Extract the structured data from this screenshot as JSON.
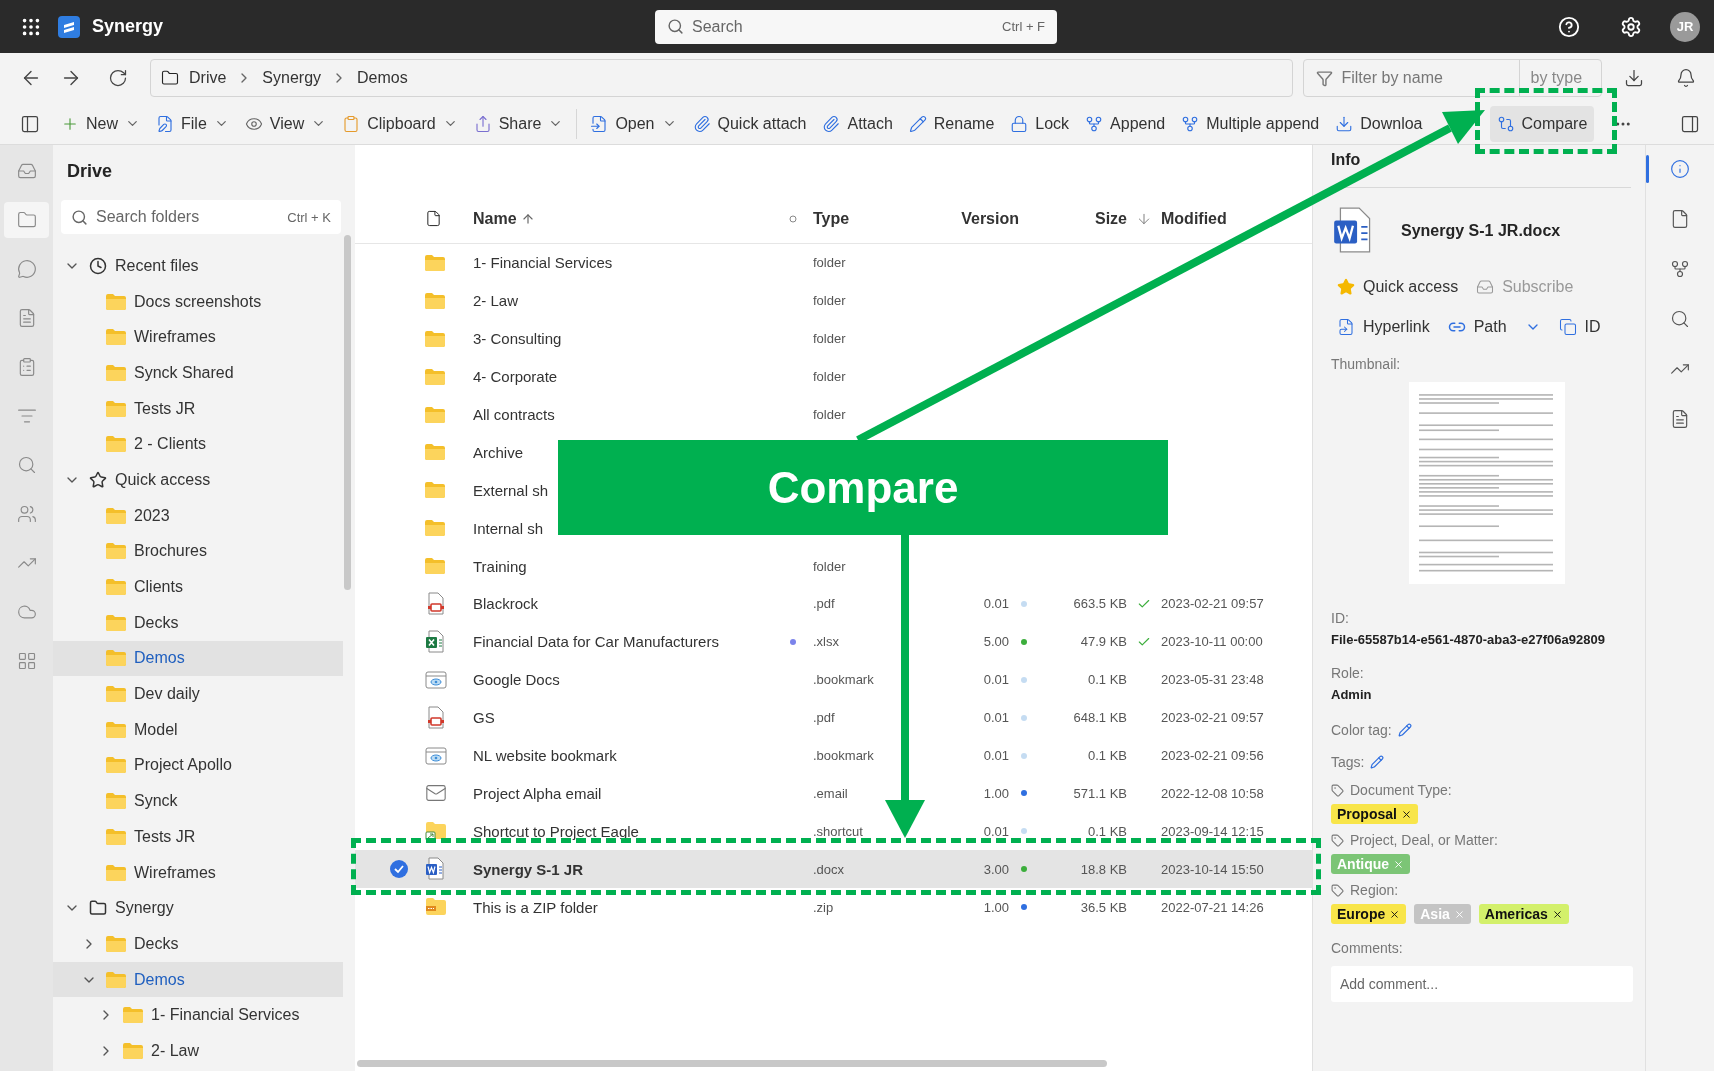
{
  "app": {
    "name": "Synergy",
    "search": {
      "placeholder": "Search",
      "shortcut": "Ctrl + F"
    },
    "avatar": "JR"
  },
  "breadcrumb": [
    {
      "label": "Drive"
    },
    {
      "label": "Synergy"
    },
    {
      "label": "Demos"
    }
  ],
  "filter": {
    "placeholder": "Filter by name",
    "type_label": "by type"
  },
  "toolbar": {
    "groups": [
      [
        {
          "label": "New",
          "dropdown": true,
          "selected": false
        },
        {
          "label": "File",
          "dropdown": true,
          "selected": false
        },
        {
          "label": "View",
          "dropdown": true,
          "selected": false
        },
        {
          "label": "Clipboard",
          "dropdown": true,
          "selected": false
        },
        {
          "label": "Share",
          "dropdown": true,
          "selected": false
        }
      ],
      [
        {
          "label": "Open",
          "dropdown": true,
          "selected": false
        },
        {
          "label": "Quick attach",
          "dropdown": false,
          "selected": false
        },
        {
          "label": "Attach",
          "dropdown": false,
          "selected": false
        },
        {
          "label": "Rename",
          "dropdown": false,
          "selected": false
        },
        {
          "label": "Lock",
          "dropdown": false,
          "selected": false
        },
        {
          "label": "Append",
          "dropdown": false,
          "selected": false
        },
        {
          "label": "Multiple append",
          "dropdown": false,
          "selected": false
        },
        {
          "label": "Downloa",
          "dropdown": false,
          "selected": false
        },
        {
          "label": "Compare",
          "dropdown": false,
          "selected": true
        }
      ]
    ]
  },
  "left_rail": [
    {
      "selected": false
    },
    {
      "selected": true
    },
    {
      "selected": false
    },
    {
      "selected": false
    },
    {
      "selected": false
    },
    {
      "selected": false
    },
    {
      "selected": false
    },
    {
      "selected": false
    },
    {
      "selected": false
    },
    {
      "selected": false
    },
    {
      "selected": false
    }
  ],
  "sidebar": {
    "title": "Drive",
    "search": {
      "placeholder": "Search folders",
      "shortcut": "Ctrl + K"
    },
    "tree": [
      {
        "label": "Recent files",
        "kind": "recent",
        "expanded": true,
        "selected": false,
        "children": [
          {
            "label": "Docs screenshots",
            "selected": false
          },
          {
            "label": "Wireframes",
            "selected": false
          },
          {
            "label": "Synck Shared",
            "selected": false
          },
          {
            "label": "Tests JR",
            "selected": false
          },
          {
            "label": "2 - Clients",
            "selected": false
          }
        ]
      },
      {
        "label": "Quick access",
        "kind": "favorites",
        "expanded": true,
        "selected": false,
        "children": [
          {
            "label": "2023",
            "selected": false
          },
          {
            "label": "Brochures",
            "selected": false
          },
          {
            "label": "Clients",
            "selected": false
          },
          {
            "label": "Decks",
            "selected": false
          },
          {
            "label": "Demos",
            "selected": true
          },
          {
            "label": "Dev daily",
            "selected": false
          },
          {
            "label": "Model",
            "selected": false
          },
          {
            "label": "Project Apollo",
            "selected": false
          },
          {
            "label": "Synck",
            "selected": false
          },
          {
            "label": "Tests JR",
            "selected": false
          },
          {
            "label": "Wireframes",
            "selected": false
          }
        ]
      },
      {
        "label": "Synergy",
        "kind": "drive",
        "expanded": true,
        "selected": false,
        "children": [
          {
            "label": "Decks",
            "expanded": false,
            "selected": false
          },
          {
            "label": "Demos",
            "expanded": true,
            "selected": true,
            "children": [
              {
                "label": "1- Financial Services",
                "expanded": false,
                "selected": false
              },
              {
                "label": "2- Law",
                "expanded": false,
                "selected": false
              }
            ]
          }
        ]
      }
    ]
  },
  "table": {
    "columns": [
      {
        "label": "Name",
        "sorted": true
      },
      {
        "label": "Type"
      },
      {
        "label": "Version"
      },
      {
        "label": "Size"
      },
      {
        "label": "Modified"
      }
    ],
    "rows": [
      {
        "name": "1- Financial Services",
        "kind": "folder",
        "type": "folder",
        "selected": false,
        "flagged": false,
        "synced": false
      },
      {
        "name": "2- Law",
        "kind": "folder",
        "type": "folder",
        "selected": false,
        "flagged": false,
        "synced": false
      },
      {
        "name": "3- Consulting",
        "kind": "folder",
        "type": "folder",
        "selected": false,
        "flagged": false,
        "synced": false
      },
      {
        "name": "4- Corporate",
        "kind": "folder",
        "type": "folder",
        "selected": false,
        "flagged": false,
        "synced": false
      },
      {
        "name": "All contracts",
        "kind": "folder",
        "type": "folder",
        "selected": false,
        "flagged": false,
        "synced": false
      },
      {
        "name": "Archive",
        "kind": "folder",
        "selected": false,
        "flagged": false,
        "synced": false
      },
      {
        "name": "External sh",
        "kind": "folder",
        "selected": false,
        "flagged": false,
        "synced": false
      },
      {
        "name": "Internal sh",
        "kind": "folder",
        "selected": false,
        "flagged": false,
        "synced": false
      },
      {
        "name": "Training",
        "kind": "folder",
        "type": "folder",
        "selected": false,
        "flagged": false,
        "synced": false
      },
      {
        "name": "Blackrock",
        "kind": "pdf",
        "type": ".pdf",
        "version": "0.01",
        "color": "#c5dcf2",
        "size": "663.5 KB",
        "synced": true,
        "modified": "2023-02-21 09:57",
        "selected": false,
        "flagged": false
      },
      {
        "name": "Financial Data for Car Manufacturers",
        "kind": "xlsx",
        "type": ".xlsx",
        "version": "5.00",
        "color": "#3cae3c",
        "size": "47.9 KB",
        "synced": true,
        "modified": "2023-10-11 00:00",
        "selected": false,
        "flagged": true
      },
      {
        "name": "Google Docs",
        "kind": "bookmark",
        "type": ".bookmark",
        "version": "0.01",
        "color": "#c5dcf2",
        "size": "0.1 KB",
        "synced": false,
        "modified": "2023-05-31 23:48",
        "selected": false,
        "flagged": false
      },
      {
        "name": "GS",
        "kind": "pdf",
        "type": ".pdf",
        "version": "0.01",
        "color": "#c5dcf2",
        "size": "648.1 KB",
        "synced": false,
        "modified": "2023-02-21 09:57",
        "selected": false,
        "flagged": false
      },
      {
        "name": "NL website bookmark",
        "kind": "bookmark",
        "type": ".bookmark",
        "version": "0.01",
        "color": "#c5dcf2",
        "size": "0.1 KB",
        "synced": false,
        "modified": "2023-02-21 09:56",
        "selected": false,
        "flagged": false
      },
      {
        "name": "Project Alpha email",
        "kind": "email",
        "type": ".email",
        "version": "1.00",
        "color": "#2f6fe0",
        "size": "571.1 KB",
        "synced": false,
        "modified": "2022-12-08 10:58",
        "selected": false,
        "flagged": false
      },
      {
        "name": "Shortcut to Project Eagle",
        "kind": "shortcut",
        "type": ".shortcut",
        "version": "0.01",
        "color": "#c5dcf2",
        "size": "0.1 KB",
        "synced": false,
        "modified": "2023-09-14 12:15",
        "selected": false,
        "flagged": false
      },
      {
        "name": "Synergy S-1 JR",
        "kind": "docx",
        "type": ".docx",
        "version": "3.00",
        "color": "#3cae3c",
        "size": "18.8 KB",
        "synced": false,
        "modified": "2023-10-14 15:50",
        "selected": true,
        "flagged": false
      },
      {
        "name": "This is a ZIP folder",
        "kind": "zip",
        "type": ".zip",
        "version": "1.00",
        "color": "#2f6fe0",
        "size": "36.5 KB",
        "synced": false,
        "modified": "2022-07-21 14:26",
        "selected": false,
        "flagged": false
      }
    ]
  },
  "info": {
    "title": "Info",
    "file_name": "Synergy S-1 JR.docx",
    "actions": [
      {
        "label": "Quick access",
        "disabled": false
      },
      {
        "label": "Subscribe",
        "disabled": true
      }
    ],
    "links": [
      {
        "label": "Hyperlink"
      },
      {
        "label": "Path"
      },
      {
        "label": "ID"
      }
    ],
    "thumbnail_label": "Thumbnail:",
    "fields": [
      {
        "label": "ID:",
        "value": "File-65587b14-e561-4870-aba3-e27f06a92809"
      },
      {
        "label": "Role:",
        "value": "Admin"
      }
    ],
    "color_tag_label": "Color tag:",
    "tags_label": "Tags:",
    "tag_groups": [
      {
        "label": "Document Type:",
        "tags": [
          {
            "label": "Proposal",
            "color": "#f8e54a"
          }
        ]
      },
      {
        "label": "Project, Deal, or Matter:",
        "tags": [
          {
            "label": "Antique",
            "color": "#7cc576"
          }
        ]
      },
      {
        "label": "Region:",
        "tags": [
          {
            "label": "Europe",
            "color": "#f8e54a"
          },
          {
            "label": "Asia",
            "color": "#c4c4c4"
          },
          {
            "label": "Americas",
            "color": "#d3f06b"
          }
        ]
      }
    ],
    "comments": {
      "label": "Comments:",
      "placeholder": "Add comment..."
    }
  },
  "right_rail": [
    {
      "selected": true
    },
    {
      "selected": false
    },
    {
      "selected": false
    },
    {
      "selected": false
    },
    {
      "selected": false
    },
    {
      "selected": false
    }
  ],
  "annotation": {
    "label": "Compare"
  }
}
